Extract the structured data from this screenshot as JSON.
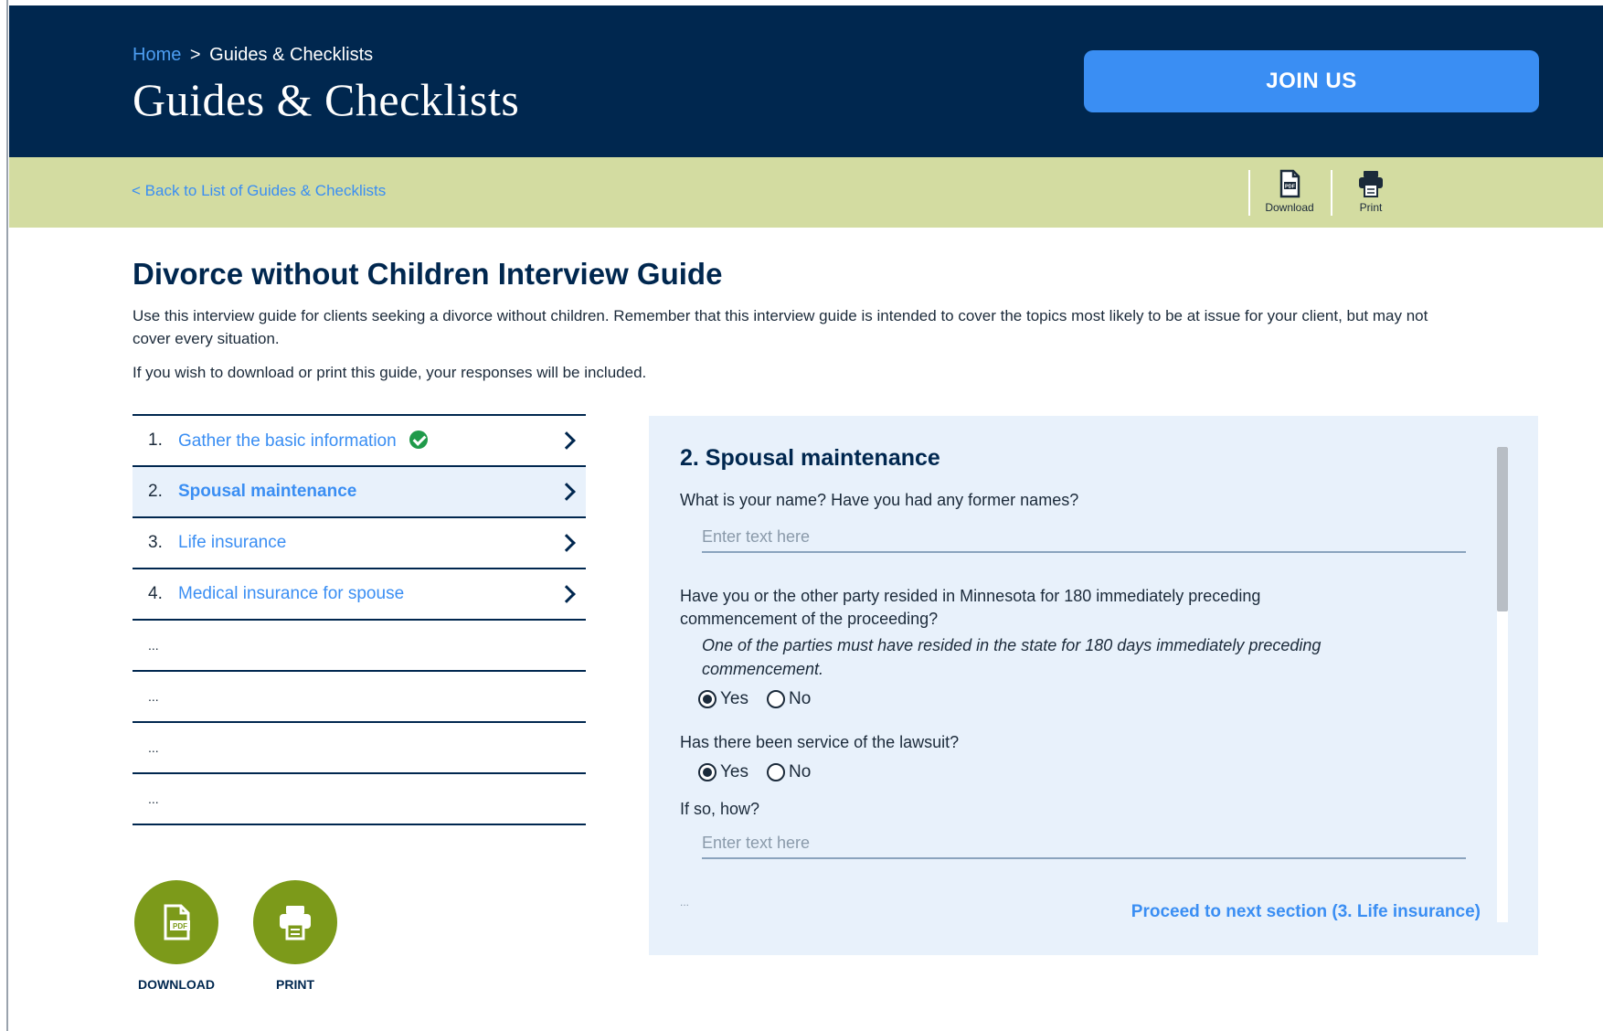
{
  "header": {
    "breadcrumb": {
      "home": "Home",
      "separator": ">",
      "current": "Guides & Checklists"
    },
    "title": "Guides & Checklists",
    "join_label": "JOIN US"
  },
  "subbar": {
    "back_link": "< Back to List of Guides & Checklists",
    "tools": {
      "download_label": "Download",
      "print_label": "Print"
    }
  },
  "guide": {
    "title": "Divorce without Children Interview Guide",
    "intro": "Use this interview guide for clients seeking a divorce without children. Remember that this interview guide is intended to cover the topics most likely to be at issue for your client, but may not cover every situation.",
    "note": "If you wish to download or print this guide, your responses will be included."
  },
  "steps": [
    {
      "num": "1.",
      "label": "Gather the basic information",
      "completed": true,
      "active": false
    },
    {
      "num": "2.",
      "label": "Spousal maintenance",
      "completed": false,
      "active": true
    },
    {
      "num": "3.",
      "label": "Life insurance",
      "completed": false,
      "active": false
    },
    {
      "num": "4.",
      "label": "Medical insurance for spouse",
      "completed": false,
      "active": false
    },
    {
      "placeholder": "..."
    },
    {
      "placeholder": "..."
    },
    {
      "placeholder": "..."
    },
    {
      "placeholder": "..."
    }
  ],
  "actions": {
    "download_label": "DOWNLOAD",
    "print_label": "PRINT"
  },
  "section": {
    "title": "2. Spousal maintenance",
    "q1": {
      "text": "What is your name? Have you had any former names?",
      "placeholder": "Enter text here"
    },
    "q2": {
      "line1": "Have you or the other party resided in Minnesota for 180 immediately preceding",
      "line2": "commencement of the proceeding?",
      "note1": "One of the parties must have resided in the state for 180 days immediately preceding",
      "note2": "commencement.",
      "yes": "Yes",
      "no": "No",
      "selected": "Yes"
    },
    "q3": {
      "text": "Has there been service of the lawsuit?",
      "yes": "Yes",
      "no": "No",
      "selected": "Yes"
    },
    "q4": {
      "text": "If so, how?",
      "placeholder": "Enter text here"
    },
    "more": "...",
    "proceed": "Proceed to next section (3. Life insurance)"
  },
  "colors": {
    "navy": "#00274f",
    "accent_blue": "#3a8ef3",
    "subbar_green": "#d3dca1",
    "action_green": "#7c9a1a",
    "check_green": "#1f9a4a",
    "panel_bg": "#e8f1fb"
  }
}
